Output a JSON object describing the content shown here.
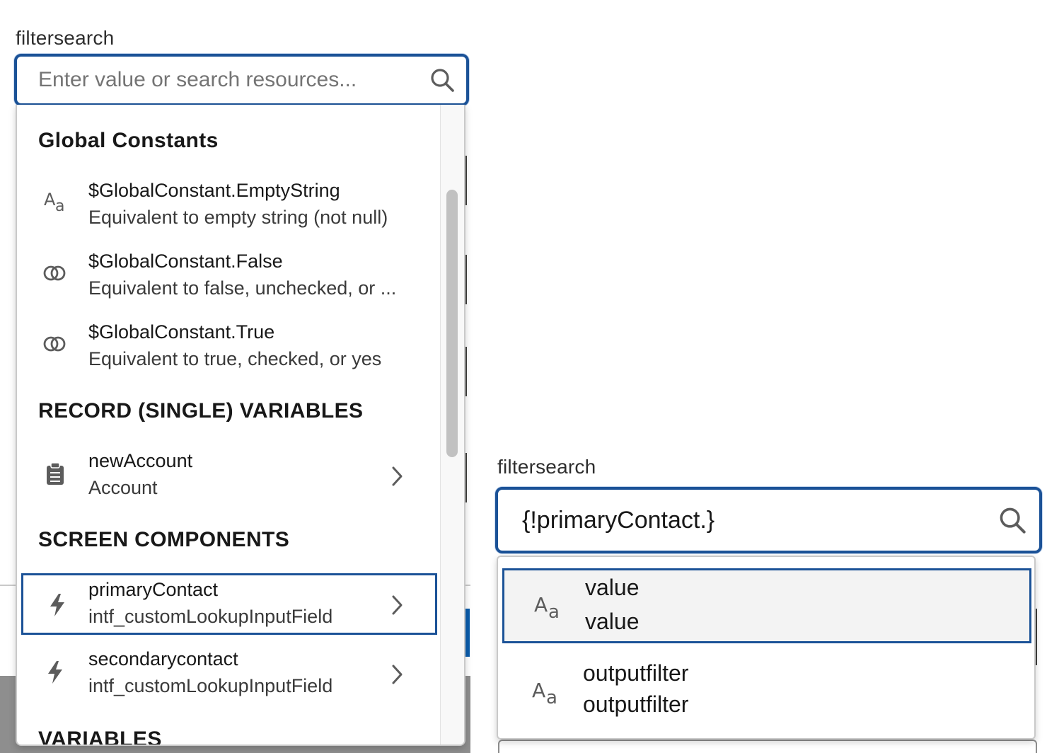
{
  "left_panel": {
    "label": "filtersearch",
    "search": {
      "value": "",
      "placeholder": "Enter value or search resources..."
    },
    "groups": [
      {
        "heading": "Global Constants",
        "options": [
          {
            "icon": "text-type-icon",
            "title": "$GlobalConstant.EmptyString",
            "subtitle": "Equivalent to empty string (not null)"
          },
          {
            "icon": "boolean-icon",
            "title": "$GlobalConstant.False",
            "subtitle": "Equivalent to false, unchecked, or ..."
          },
          {
            "icon": "boolean-icon",
            "title": "$GlobalConstant.True",
            "subtitle": "Equivalent to true, checked, or yes"
          }
        ]
      },
      {
        "heading": "RECORD (SINGLE) VARIABLES",
        "options": [
          {
            "icon": "record-icon",
            "title": "newAccount",
            "subtitle": "Account",
            "has_children": true
          }
        ]
      },
      {
        "heading": "SCREEN COMPONENTS",
        "options": [
          {
            "icon": "lightning-icon",
            "title": "primaryContact",
            "subtitle": "intf_customLookupInputField",
            "has_children": true,
            "focused": true
          },
          {
            "icon": "lightning-icon",
            "title": "secondarycontact",
            "subtitle": "intf_customLookupInputField",
            "has_children": true
          }
        ]
      },
      {
        "heading": "VARIABLES",
        "options": []
      }
    ]
  },
  "right_panel": {
    "label": "filtersearch",
    "search": {
      "value": "{!primaryContact.}",
      "placeholder": ""
    },
    "options": [
      {
        "icon": "text-type-icon",
        "title": "value",
        "subtitle": "value",
        "focused": true
      },
      {
        "icon": "text-type-icon",
        "title": "outputfilter",
        "subtitle": "outputfilter"
      }
    ]
  },
  "colors": {
    "focus_border": "#1b5297",
    "text": "#181818",
    "icon": "#5c5c5c"
  }
}
